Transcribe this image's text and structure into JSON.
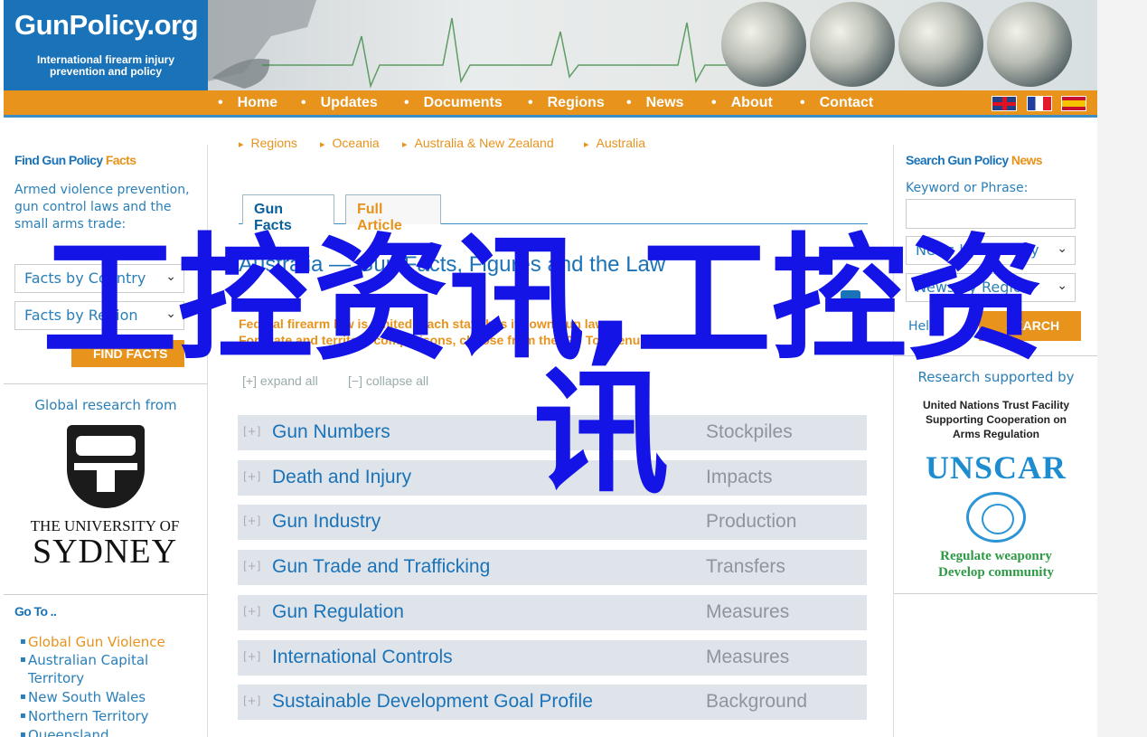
{
  "header": {
    "logo_name": "GunPolicy.org",
    "logo_sub": "International firearm injury prevention and policy"
  },
  "nav": {
    "items": [
      "Home",
      "Updates",
      "Documents",
      "Regions",
      "News",
      "About",
      "Contact"
    ],
    "flags": [
      "english-flag",
      "french-flag",
      "spanish-flag"
    ]
  },
  "left": {
    "find_title_a": "Find Gun Policy",
    "find_title_b": "Facts",
    "find_text": "Armed violence prevention, gun control laws and the small arms trade:",
    "select_1": "Facts by Country",
    "select_2": "Facts by Region",
    "find_button": "FIND FACTS",
    "global_research": "Global research from",
    "uni_line1": "THE UNIVERSITY OF",
    "uni_line2": "SYDNEY",
    "goto_title": "Go To ..",
    "goto_items": [
      "Global Gun Violence",
      "Australian Capital Territory",
      "New South Wales",
      "Northern Territory",
      "Queensland"
    ]
  },
  "main": {
    "breadcrumbs": [
      "Regions",
      "Oceania",
      "Australia & New Zealand",
      "Australia"
    ],
    "tab_facts": "Gun Facts",
    "tab_article": "Full Article",
    "heading": "Australia — Gun Facts, Figures and the Law",
    "intro_line1": "Federal firearm law is limited: each state has its own gun law.",
    "intro_line2": "For state and territory comparisons, choose from the 'Go To' menu.",
    "expand_all": "expand all",
    "collapse_all": "collapse all",
    "sections": [
      {
        "title": "Gun Numbers",
        "subtitle": "Stockpiles"
      },
      {
        "title": "Death and Injury",
        "subtitle": "Impacts"
      },
      {
        "title": "Gun Industry",
        "subtitle": "Production"
      },
      {
        "title": "Gun Trade and Trafficking",
        "subtitle": "Transfers"
      },
      {
        "title": "Gun Regulation",
        "subtitle": "Measures"
      },
      {
        "title": "International Controls",
        "subtitle": "Measures"
      },
      {
        "title": "Sustainable Development Goal Profile",
        "subtitle": "Background"
      }
    ]
  },
  "right": {
    "search_title_a": "Search Gun Policy",
    "search_title_b": "News",
    "keyword_label": "Keyword or Phrase:",
    "select_1": "News by Country",
    "select_2": "News by Region",
    "help": "Help",
    "search_button": "SEARCH",
    "research_supported": "Research supported by",
    "unscar_line1": "United Nations Trust Facility",
    "unscar_line2": "Supporting Cooperation on",
    "unscar_line3": "Arms Regulation",
    "unscar_name": "UNSCAR",
    "unscar_tag1": "Regulate weaponry",
    "unscar_tag2": "Develop community"
  },
  "watermark": {
    "line1": "工控资讯,工控资",
    "line2": "讯"
  },
  "colors": {
    "brand_blue": "#1a73b8",
    "nav_orange": "#e7931c",
    "watermark_blue": "#1414e6",
    "unscar_blue": "#1e8dd0",
    "unscar_green": "#2e9a45"
  }
}
